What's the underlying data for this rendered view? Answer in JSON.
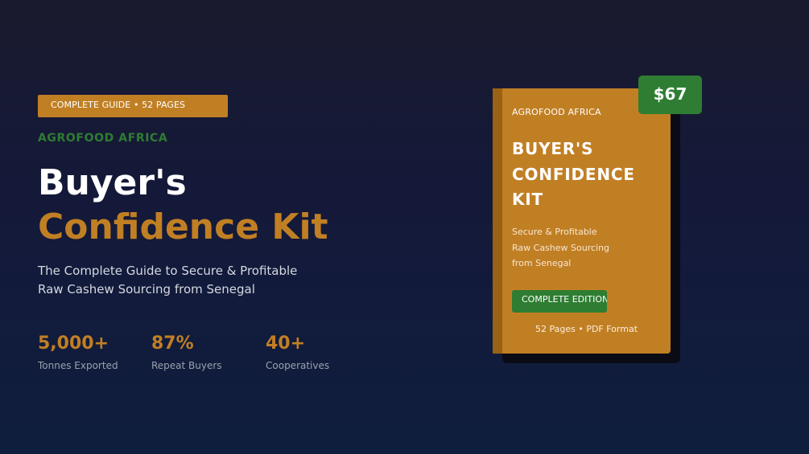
{
  "hero": {
    "badge": "COMPLETE GUIDE • 52 PAGES",
    "brand": "AGROFOOD AFRICA",
    "title_line1": "Buyer's",
    "title_line2": "Confidence Kit",
    "subtitle_line1": "The Complete Guide to Secure & Profitable",
    "subtitle_line2": "Raw Cashew Sourcing from Senegal"
  },
  "stats": [
    {
      "value": "5,000+",
      "label": "Tonnes Exported"
    },
    {
      "value": "87%",
      "label": "Repeat Buyers"
    },
    {
      "value": "40+",
      "label": "Cooperatives"
    }
  ],
  "book": {
    "brand": "AGROFOOD AFRICA",
    "title_lines": [
      "BUYER'S",
      "CONFIDENCE",
      "KIT"
    ],
    "subtitle_lines": [
      "Secure & Profitable",
      "Raw Cashew Sourcing",
      "from Senegal"
    ],
    "edition": "COMPLETE EDITION",
    "meta": "52 Pages • PDF Format"
  },
  "price": "$67",
  "colors": {
    "accent_orange": "#c17f24",
    "accent_green": "#2e7d32",
    "background": "#14193a"
  }
}
